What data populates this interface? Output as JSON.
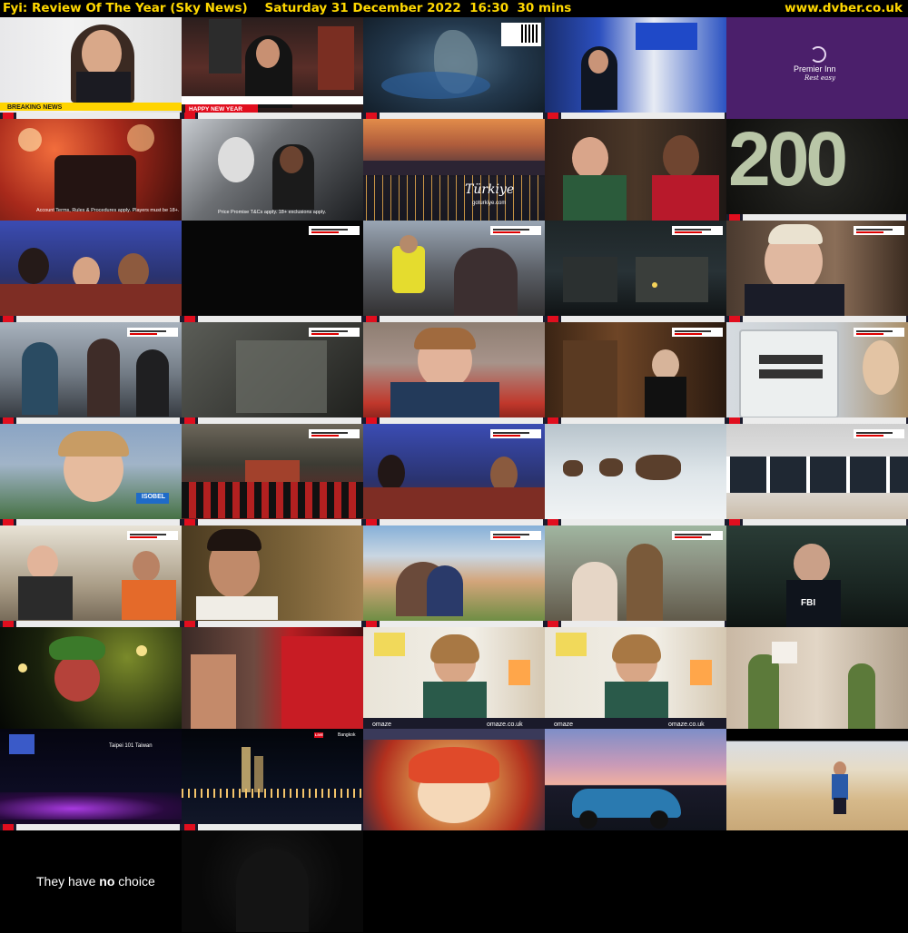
{
  "header": {
    "title": "Fyi: Review Of The Year (Sky News)    Saturday 31 December 2022  16:30  30 mins",
    "site": "www.dvber.co.uk"
  },
  "overlays": {
    "breaking_news": "BREAKING NEWS",
    "happy_new_year": "HAPPY NEW YEAR",
    "premier_inn": "Premier Inn",
    "premier_inn_tagline": "Rest easy",
    "turkiye": "Türkiye",
    "goturkiye": "goturkiye.com",
    "number_200": "200",
    "isobel": "ISOBEL",
    "fbi": "FBI",
    "omaze": "omaze",
    "omaze_url": "omaze.co.uk",
    "taipei": "Taipei 101 Taiwan",
    "bangkok": "Bangkok",
    "live": "LIVE",
    "closing_caption_pre": "They have ",
    "closing_caption_bold": "no",
    "closing_caption_post": " choice",
    "segment_title": "2022 - AS IT WAS",
    "segments": {
      "ukraine": "UKRAINE INVASION",
      "politics": "POLITICAL DRAMA",
      "remember": "REMEMBERING THE QUEEN",
      "climate": "CLIMATE CHANGE",
      "stories": "YOUR STORIES"
    },
    "small_caption_1": "Account Terms, Rules & Procedures apply. Players must be 18+.",
    "small_caption_2": "Price Promise T&Cs apply. 18+ exclusions apply."
  },
  "colors": {
    "header_text": "#ffd800",
    "sky_red": "#e10e1e",
    "breaking_yellow": "#ffd400",
    "premier_purple": "#4b1f6b"
  }
}
